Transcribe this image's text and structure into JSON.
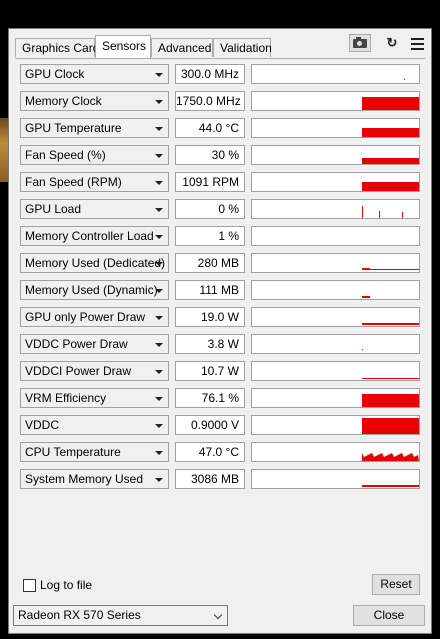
{
  "tabs": [
    {
      "label": "Graphics Card",
      "active": false
    },
    {
      "label": "Sensors",
      "active": true
    },
    {
      "label": "Advanced",
      "active": false
    },
    {
      "label": "Validation",
      "active": false
    }
  ],
  "toolbar_icons": [
    "camera-icon",
    "refresh-icon",
    "menu-icon"
  ],
  "sensors": [
    {
      "name": "GPU Clock",
      "value": "300.0 MHz",
      "graph": "sparse"
    },
    {
      "name": "Memory Clock",
      "value": "1750.0 MHz",
      "graph": "full-high"
    },
    {
      "name": "GPU Temperature",
      "value": "44.0 °C",
      "graph": "full-mid"
    },
    {
      "name": "Fan Speed (%)",
      "value": "30 %",
      "graph": "full-low"
    },
    {
      "name": "Fan Speed (RPM)",
      "value": "1091 RPM",
      "graph": "full-mid"
    },
    {
      "name": "GPU Load",
      "value": "0 %",
      "graph": "spikes"
    },
    {
      "name": "Memory Controller Load",
      "value": "1 %",
      "graph": "empty"
    },
    {
      "name": "Memory Used (Dedicated)",
      "value": "280 MB",
      "graph": "thin-line"
    },
    {
      "name": "Memory Used (Dynamic)",
      "value": "111 MB",
      "graph": "tiny-start"
    },
    {
      "name": "GPU only Power Draw",
      "value": "19.0 W",
      "graph": "thin-line2"
    },
    {
      "name": "VDDC Power Draw",
      "value": "3.8 W",
      "graph": "dot"
    },
    {
      "name": "VDDCI Power Draw",
      "value": "10.7 W",
      "graph": "thin-line3"
    },
    {
      "name": "VRM Efficiency",
      "value": "76.1 %",
      "graph": "full-high"
    },
    {
      "name": "VDDC",
      "value": "0.9000 V",
      "graph": "full-top"
    },
    {
      "name": "CPU Temperature",
      "value": "47.0 °C",
      "graph": "noisy"
    },
    {
      "name": "System Memory Used",
      "value": "3086 MB",
      "graph": "thin-line4"
    }
  ],
  "graph_color": "#e80000",
  "log_to_file": {
    "label": "Log to file",
    "checked": false
  },
  "reset_label": "Reset",
  "gpu_select": {
    "value": "Radeon RX 570 Series"
  },
  "close_label": "Close"
}
